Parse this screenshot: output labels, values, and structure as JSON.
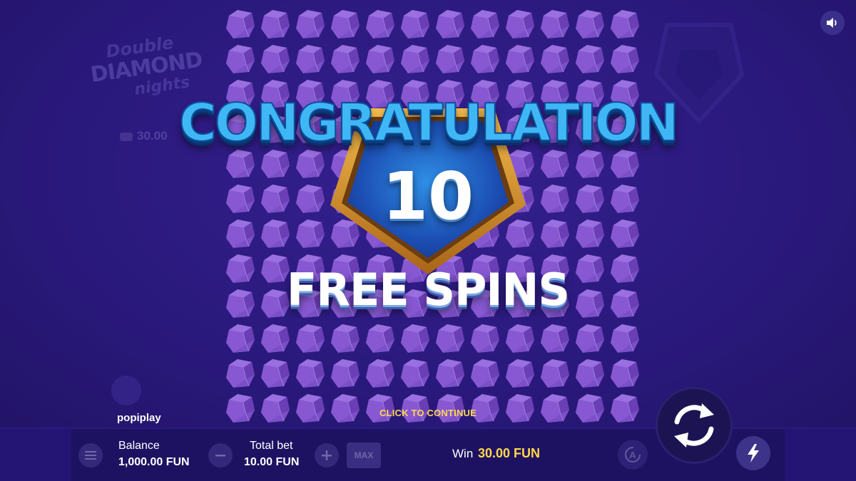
{
  "game": {
    "logo": {
      "line1": "Double",
      "line2": "DIAMOND",
      "line3": "nights"
    },
    "left_win_value": "30.00",
    "brand": "popiplay"
  },
  "overlay": {
    "title": "CONGRATULATION",
    "count": "10",
    "subtitle": "FREE SPINS",
    "continue_label": "CLICK TO CONTINUE"
  },
  "grid": {
    "columns": 12,
    "rows": 12,
    "symbol": "purple-crystal-icon"
  },
  "bottom_bar": {
    "balance_label": "Balance",
    "balance_value": "1,000.00 FUN",
    "total_bet_label": "Total bet",
    "total_bet_value": "10.00 FUN",
    "max_label": "MAX",
    "win_label": "Win",
    "win_value": "30.00 FUN"
  },
  "icons": {
    "menu": "menu-icon",
    "minus": "minus-icon",
    "plus": "plus-icon",
    "autoplay": "autoplay-icon",
    "spin": "spin-arrows-icon",
    "turbo": "lightning-icon",
    "sound": "speaker-icon"
  },
  "colors": {
    "background": "#2a1a7e",
    "title_blue": "#3fb7f5",
    "accent_yellow": "#ffd84a",
    "frame_gold": "#c9862a"
  }
}
